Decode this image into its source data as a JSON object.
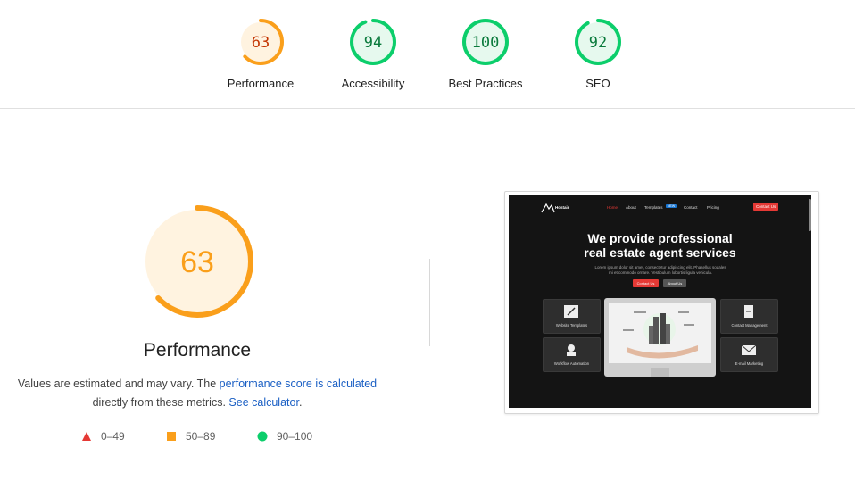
{
  "categories": [
    {
      "label": "Performance",
      "score": "63",
      "fraction": 0.63,
      "color": "#fa9f1b",
      "textColor": "#c33300",
      "bg": "#fff3e0"
    },
    {
      "label": "Accessibility",
      "score": "94",
      "fraction": 0.94,
      "color": "#0cce6b",
      "textColor": "#0a7a3c",
      "bg": "#e6f9ee"
    },
    {
      "label": "Best Practices",
      "score": "100",
      "fraction": 1.0,
      "color": "#0cce6b",
      "textColor": "#0a7a3c",
      "bg": "#e6f9ee"
    },
    {
      "label": "SEO",
      "score": "92",
      "fraction": 0.92,
      "color": "#0cce6b",
      "textColor": "#0a7a3c",
      "bg": "#e6f9ee"
    }
  ],
  "main": {
    "score": "63",
    "fraction": 0.63,
    "title": "Performance",
    "desc_pre": "Values are estimated and may vary. The ",
    "desc_link1": "performance score is calculated",
    "desc_mid": "directly from these metrics. ",
    "desc_link2": "See calculator",
    "desc_post": "."
  },
  "legend": [
    {
      "range": "0–49",
      "shape": "triangle",
      "color": "#e53935"
    },
    {
      "range": "50–89",
      "shape": "square",
      "color": "#fa9f1b"
    },
    {
      "range": "90–100",
      "shape": "circle",
      "color": "#0cce6b"
    }
  ],
  "screenshot": {
    "brand": "Hostair",
    "nav": [
      "Home",
      "About",
      "Templates",
      "Contact",
      "Pricing"
    ],
    "nav_badge": "NEW",
    "nav_button": "Contact Us",
    "headline1": "We provide professional",
    "headline2": "real estate agent services",
    "paragraph": "Lorem ipsum dolor sit amet, consectetur adipiscing elit. Phasellus sodales mi et commodo ornare. Vestibulum lobortis ligula vehicula.",
    "btn_primary": "Contact Us",
    "btn_secondary": "About Us",
    "cards": [
      "Website Templates",
      "Workflow Automation",
      "Contact Management",
      "E-mail Marketing"
    ]
  }
}
